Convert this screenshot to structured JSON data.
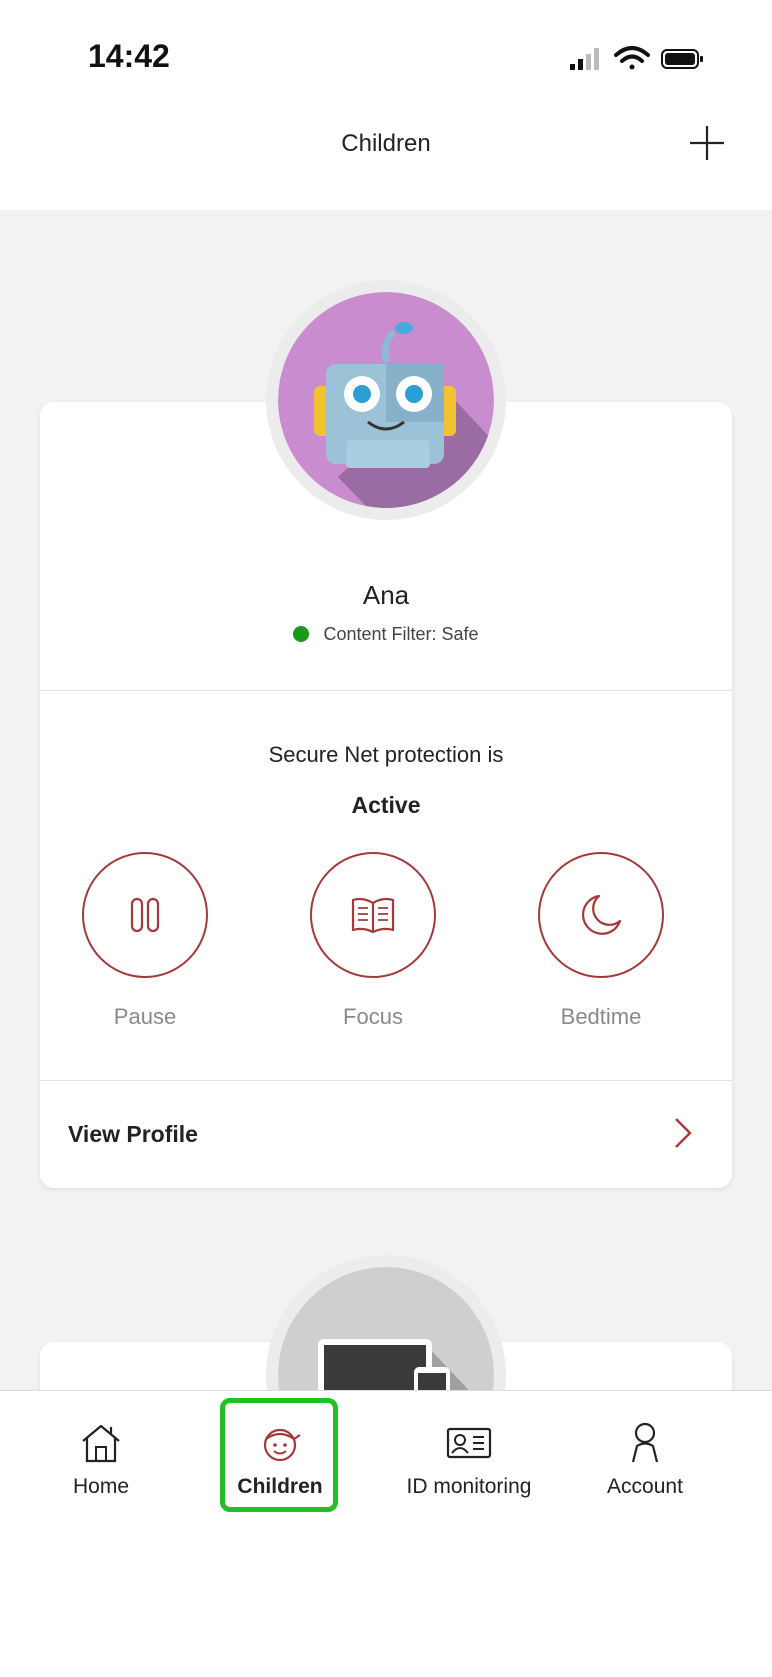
{
  "status_bar": {
    "time": "14:42"
  },
  "header": {
    "title": "Children"
  },
  "child_card": {
    "name": "Ana",
    "content_filter": "Content Filter: Safe",
    "protection_text": "Secure Net protection is",
    "protection_status": "Active",
    "actions": [
      {
        "label": "Pause",
        "icon": "pause-icon"
      },
      {
        "label": "Focus",
        "icon": "book-icon"
      },
      {
        "label": "Bedtime",
        "icon": "moon-icon"
      }
    ],
    "view_profile_label": "View Profile"
  },
  "tab_bar": {
    "active": "Children",
    "items": [
      {
        "label": "Home",
        "icon": "home-icon"
      },
      {
        "label": "Children",
        "icon": "child-face-icon"
      },
      {
        "label": "ID monitoring",
        "icon": "id-card-icon"
      },
      {
        "label": "Account",
        "icon": "person-icon"
      }
    ]
  },
  "colors": {
    "accent": "#a5393a",
    "active_status": "#1a9a1a",
    "highlight": "#22c122",
    "avatar_bg": "#c98ccf"
  }
}
